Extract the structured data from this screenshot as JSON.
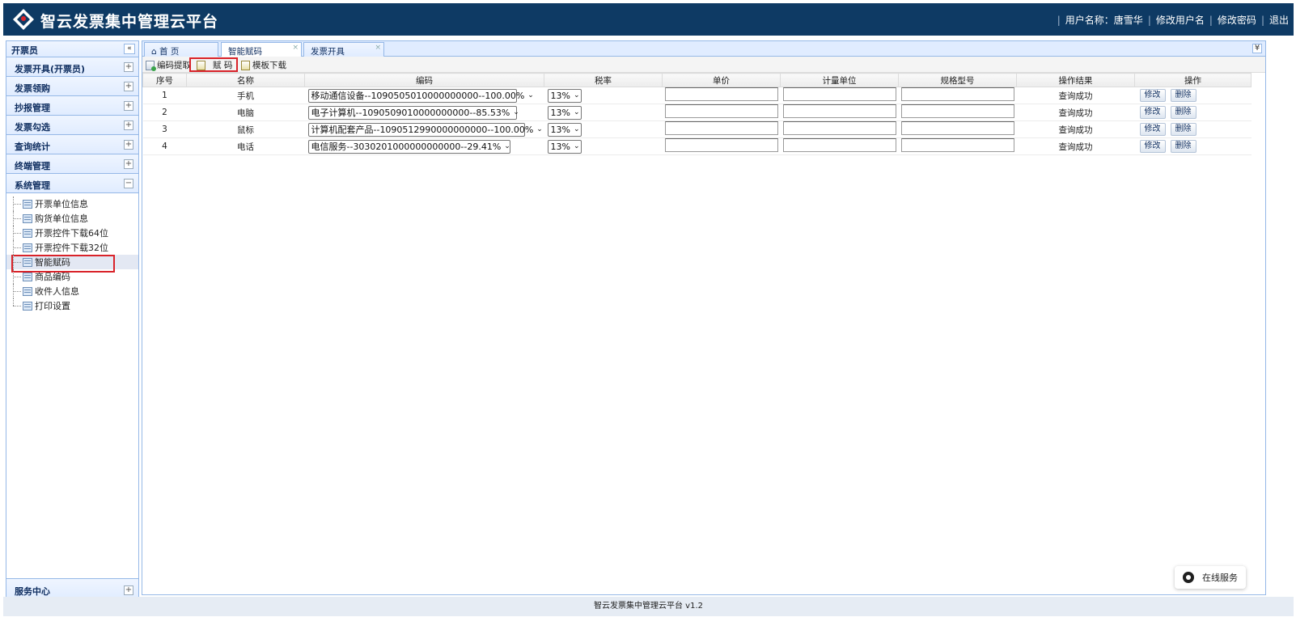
{
  "header": {
    "title": "智云发票集中管理云平台",
    "user_label": "用户名称：唐雪华",
    "links": [
      "修改用户名",
      "修改密码",
      "退出"
    ]
  },
  "sidebar": {
    "title": "开票员",
    "collapse_glyph": "«",
    "groups": [
      {
        "label": "发票开具(开票员)",
        "toggle": "+"
      },
      {
        "label": "发票领购",
        "toggle": "+"
      },
      {
        "label": "抄报管理",
        "toggle": "+"
      },
      {
        "label": "发票勾选",
        "toggle": "+"
      },
      {
        "label": "查询统计",
        "toggle": "+"
      },
      {
        "label": "终端管理",
        "toggle": "+"
      },
      {
        "label": "系统管理",
        "toggle": "−"
      }
    ],
    "sub_items": [
      "开票单位信息",
      "购货单位信息",
      "开票控件下载64位",
      "开票控件下载32位",
      "智能赋码",
      "商品编码",
      "收件人信息",
      "打印设置"
    ],
    "selected_item": "智能赋码",
    "service_group": {
      "label": "服务中心",
      "toggle": "+"
    }
  },
  "tabs": [
    {
      "label": "首  页",
      "icon": "home-icon",
      "closable": false
    },
    {
      "label": "智能赋码",
      "closable": true,
      "active": true
    },
    {
      "label": "发票开具",
      "closable": true
    }
  ],
  "tab_menu_glyph": "¥",
  "toolbar": {
    "extract_label": "编码提取",
    "assign_label": "赋  码",
    "template_label": "模板下载"
  },
  "table": {
    "headers": [
      "序号",
      "名称",
      "编码",
      "税率",
      "单价",
      "计量单位",
      "规格型号",
      "操作结果",
      "操作"
    ],
    "rows": [
      {
        "no": "1",
        "name": "手机",
        "code": "移动通信设备--1090505010000000000--100.00%",
        "rate": "13%",
        "result": "查询成功"
      },
      {
        "no": "2",
        "name": "电脑",
        "code": "电子计算机--1090509010000000000--85.53%",
        "rate": "13%",
        "result": "查询成功"
      },
      {
        "no": "3",
        "name": "鼠标",
        "code": "计算机配套产品--1090512990000000000--100.00%",
        "rate": "13%",
        "result": "查询成功"
      },
      {
        "no": "4",
        "name": "电话",
        "code": "电信服务--3030201000000000000--29.41%",
        "rate": "13%",
        "result": "查询成功"
      }
    ],
    "edit_label": "修改",
    "delete_label": "删除"
  },
  "chat_widget": {
    "label": "在线服务"
  },
  "footer": {
    "text": "智云发票集中管理云平台  v1.2"
  },
  "colors": {
    "header_bg": "#0e3a64",
    "panel_border": "#95b8e7",
    "highlight_frame": "#d9232a"
  }
}
